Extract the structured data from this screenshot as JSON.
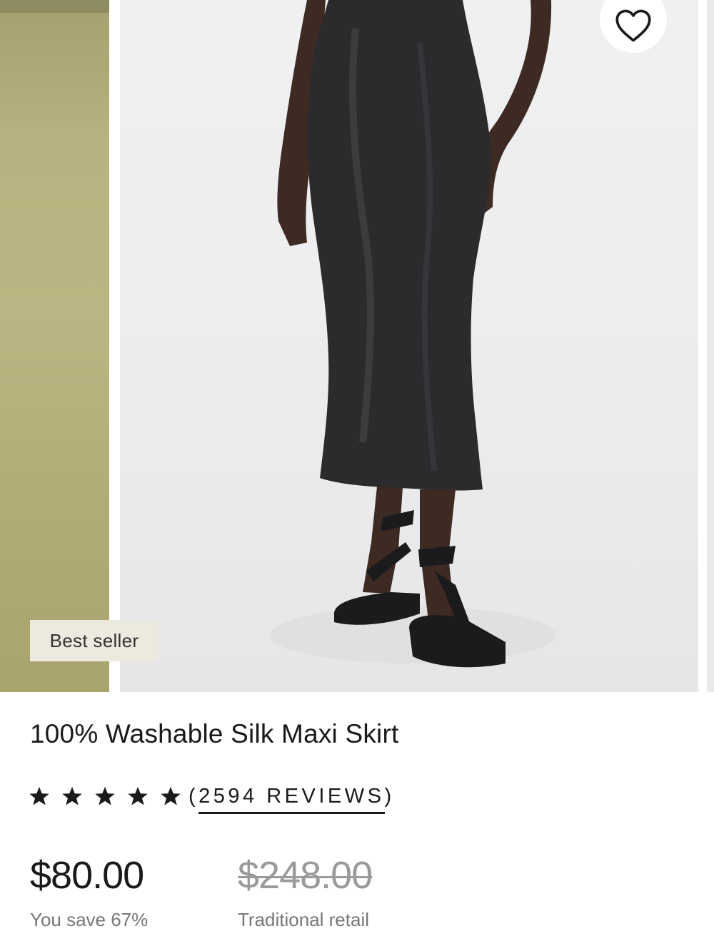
{
  "gallery": {
    "badge": "Best seller",
    "favorite_icon": "heart-outline-icon",
    "main_image_alt": "100% Washable Silk Maxi Skirt"
  },
  "product": {
    "title": "100% Washable Silk Maxi Skirt",
    "rating": {
      "stars": 5,
      "max_stars": 5,
      "star_icon": "star-filled-icon",
      "reviews_open": "(",
      "reviews_count": "2594 REVIEWS",
      "reviews_close": ")"
    },
    "price": "$80.00",
    "savings": "You save 67%",
    "retail_price": "$248.00",
    "retail_label": "Traditional retail"
  },
  "colors": {
    "text": "#1a1a1a",
    "muted": "#777777",
    "strike": "#9a9a9a",
    "badge_bg": "#ece9df",
    "accent_prev": "#b7b27f"
  }
}
